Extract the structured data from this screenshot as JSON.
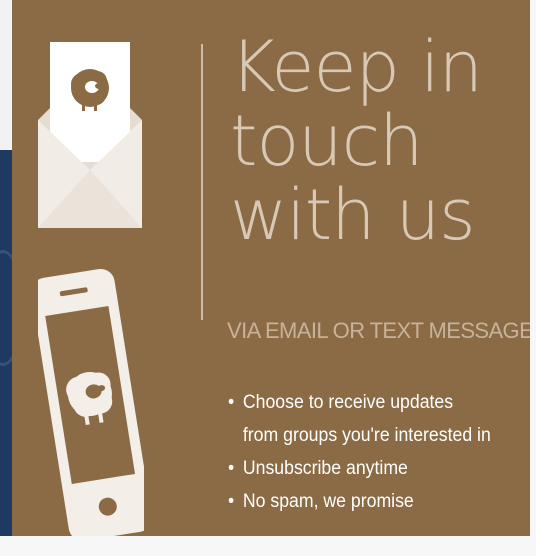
{
  "colors": {
    "card_background": "#8b6b45",
    "headline_text": "#d8c8b6",
    "subhead_text": "#c7b29a",
    "bullet_text": "#ffffff",
    "envelope": "#ece5dc",
    "phone": "#f3eee8",
    "left_strip": "#1f3a62"
  },
  "icons": {
    "envelope": "envelope-with-sheep-letter-icon",
    "phone": "smartphone-with-sheep-icon",
    "sheep": "sheep-icon"
  },
  "headline": {
    "line1": "Keep in",
    "line2": "touch",
    "line3": "with us"
  },
  "subhead": "VIA EMAIL OR TEXT MESSAGE",
  "bullets": {
    "item1_line1": "Choose to receive updates",
    "item1_line2": "from groups you're interested in",
    "item2": "Unsubscribe anytime",
    "item3": "No spam, we promise"
  },
  "bullet_glyph": "•"
}
